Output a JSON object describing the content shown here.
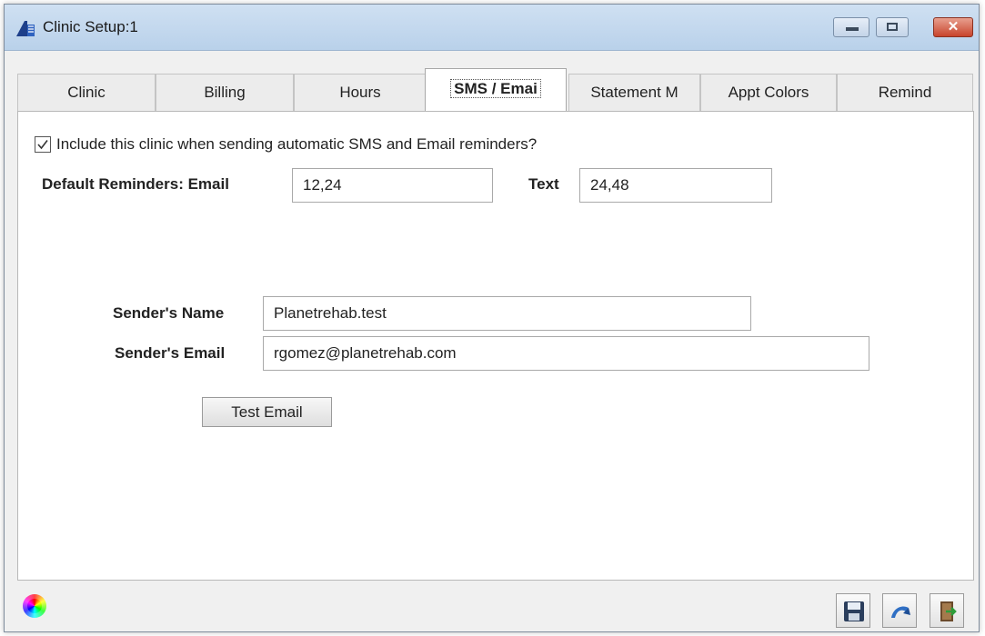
{
  "window": {
    "title": "Clinic Setup:1",
    "icon": "clinic-app-icon",
    "controls": [
      "minimize",
      "maximize",
      "close"
    ],
    "close_glyph": "✕"
  },
  "tabs": [
    {
      "label": "Clinic",
      "active": false
    },
    {
      "label": "Billing",
      "active": false
    },
    {
      "label": "Hours",
      "active": false
    },
    {
      "label": "SMS / Emai",
      "active": true
    },
    {
      "label": "Statement M",
      "active": false
    },
    {
      "label": "Appt Colors",
      "active": false
    },
    {
      "label": "Remind",
      "active": false
    }
  ],
  "sms_email": {
    "include_checkbox": {
      "label": "Include this clinic when sending automatic SMS and Email reminders?",
      "checked": true
    },
    "default_reminders_label": "Default Reminders: Email",
    "email_value": "12,24",
    "text_label": "Text",
    "text_value": "24,48",
    "sender_name_label": "Sender's Name",
    "sender_name_value": "Planetrehab.test",
    "sender_email_label": "Sender's Email",
    "sender_email_value": "rgomez@planetrehab.com",
    "test_email_button": "Test Email"
  },
  "bottom_toolbar": {
    "icons": [
      "color-wheel-icon",
      "save-icon",
      "undo-icon",
      "exit-icon"
    ]
  },
  "colors": {
    "titlebar": "#c4d8ee",
    "close_button": "#c8442c",
    "content_background": "#ffffff",
    "window_background": "#f0f0f0"
  }
}
